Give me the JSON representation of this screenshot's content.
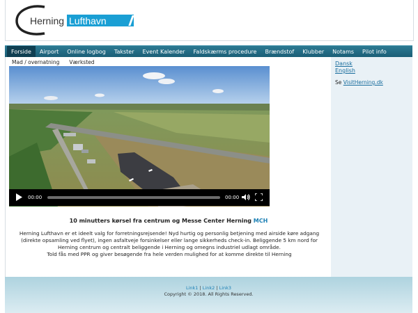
{
  "logo": {
    "word1": "Herning",
    "word2": "Lufthavn"
  },
  "nav": {
    "items": [
      "Forside",
      "Airport",
      "Online logbog",
      "Takster",
      "Event Kalender",
      "Faldskærms procedure",
      "Brændstof",
      "Klubber",
      "Notams",
      "Pilot info"
    ],
    "active": "Forside"
  },
  "subnav": {
    "item1": "Mad / overnatning",
    "item2": "Værksted"
  },
  "video": {
    "time_current": "00:00",
    "time_total": "00:00"
  },
  "content": {
    "headline": "10 minutters kørsel fra centrum og Messe Center Herning",
    "headline_link": "MCH",
    "body_lines": [
      "Herning Lufthavn er et ideelt valg for forretningsrejsende! Nyd hurtig og personlig betjening med airside køre adgang",
      "(direkte opsamling ved flyet), ingen asfaltveje forsinkelser eller lange sikkerheds check-in. Beliggende 5 km nord for",
      "Herning centrum og centralt beliggende i Herning og omegns industriel udlagt område.",
      "Told fås med PPR og giver besøgende fra hele verden mulighed for at komme direkte til Herning"
    ]
  },
  "sidebar": {
    "dansk": "Dansk",
    "english": "English",
    "see_prefix": "Se",
    "visit_link": "VisitHerning.dk"
  },
  "footer": {
    "link1": "Link1",
    "link2": "Link2",
    "link3": "Link3",
    "sep": "|",
    "copyright": "Copyright © 2018. All Rights Reserved."
  },
  "colors": {
    "nav": "#1a5d75",
    "accent": "#1a9fd4",
    "footer": "#aed3df",
    "sidebar": "#e9f1f6"
  }
}
